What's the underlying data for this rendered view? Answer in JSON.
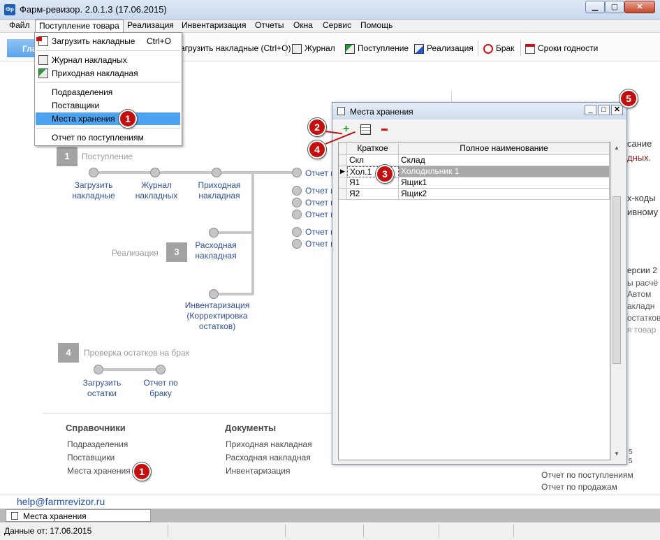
{
  "window": {
    "title": "Фарм-ревизор. 2.0.1.3 (17.06.2015)",
    "app_icon": "Фр"
  },
  "menu": [
    "Файл",
    "Поступление товара",
    "Реализация",
    "Инвентаризация",
    "Отчеты",
    "Окна",
    "Сервис",
    "Помощь"
  ],
  "main_tab": "Гла",
  "toolbar": {
    "load": "агрузить накладные (Ctrl+O)",
    "journal": "Журнал",
    "receipt": "Поступление",
    "sale": "Реализация",
    "defect": "Брак",
    "expiry": "Сроки годности"
  },
  "dropdown": {
    "load": "Загрузить накладные",
    "shortcut": "Ctrl+O",
    "journal": "Журнал накладных",
    "invoice": "Приходная накладная",
    "departments": "Подразделения",
    "suppliers": "Поставщики",
    "storage": "Места хранения",
    "report": "Отчет по поступлениям"
  },
  "badges": [
    "1",
    "2",
    "3",
    "4",
    "5"
  ],
  "workflow": {
    "s1_num": "1",
    "s1_title": "Поступление",
    "load": "Загрузить\nнакладные",
    "journal": "Журнал\nнакладных",
    "invoice": "Приходная\nнакладная",
    "report_short": "Отчет п",
    "s3_title": "Реализация",
    "s3_num": "3",
    "expense": "Расходная\nнакладная",
    "inventory": "Инвентаризация\n(Корректировка\nостатков)",
    "s4_num": "4",
    "s4_title": "Проверка остатков на брак",
    "load_rest": "Загрузить\nостатки",
    "defect_report": "Отчет по\nбраку"
  },
  "right_fragments": [
    "сание",
    "дных.",
    "х-коды",
    "ивному",
    "ерсии 2",
    "ы расчё",
    "Автом",
    "акладн",
    "остатков",
    "я товар"
  ],
  "refs": {
    "title": "Справочники",
    "items": [
      "Подразделения",
      "Поставщики",
      "Места хранения"
    ]
  },
  "docs": {
    "title": "Документы",
    "items": [
      "Приходная накладная",
      "Расходная накладная",
      "Инвентаризация"
    ]
  },
  "reports": {
    "items": [
      "Отчет по поступлениям",
      "Отчет по продажам"
    ],
    "frag": "5"
  },
  "email": "help@farmrevizor.ru",
  "subwindow": {
    "title": "Места хранения",
    "headers": [
      "Краткое",
      "Полное наименование"
    ],
    "rows": [
      {
        "short": "Скл",
        "full": "Склад"
      },
      {
        "short": "Хол.1",
        "full": "Холодильник 1"
      },
      {
        "short": "Я1",
        "full": "Ящик1"
      },
      {
        "short": "Я2",
        "full": "Ящик2"
      }
    ],
    "selected_row": 1
  },
  "tab_bottom": "Места хранения",
  "status": "Данные от: 17.06.2015",
  "colors": {
    "accent": "#4ca3f1",
    "badge": "#c40f0f",
    "link": "#2f4f98"
  }
}
